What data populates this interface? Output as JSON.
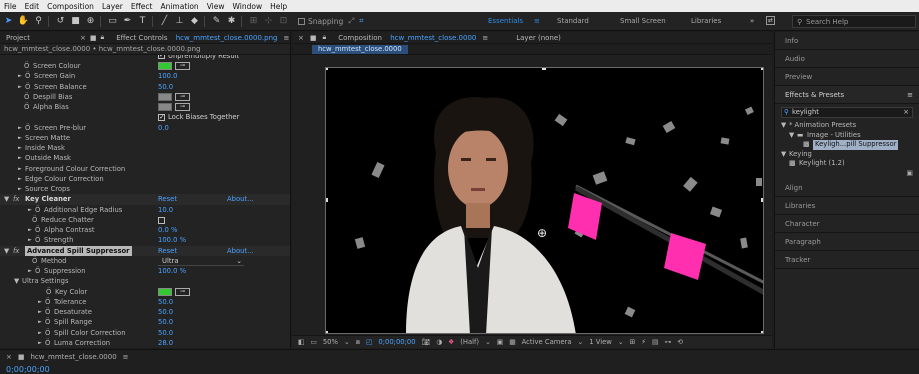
{
  "menubar": [
    "File",
    "Edit",
    "Composition",
    "Layer",
    "Effect",
    "Animation",
    "View",
    "Window",
    "Help"
  ],
  "toolbar": {
    "snapping_label": "Snapping",
    "workspaces": [
      "Essentials",
      "Standard",
      "Small Screen",
      "Libraries"
    ],
    "active_workspace": "Essentials",
    "search_help_placeholder": "Search Help"
  },
  "left_panel": {
    "project_tab": "Project",
    "effect_controls_tab_prefix": "Effect Controls",
    "effect_controls_tab_file": "hcw_mmtest_close.0000.png",
    "source_path": "hcw_mmtest_close.0000 • hcw_mmtest_close.0000.png",
    "rows": [
      {
        "name": "Unpremultiply Result",
        "indent": 150,
        "kind": "text_white",
        "partial": true
      },
      {
        "name": "Screen Colour",
        "indent": 24,
        "kind": "swatch_green"
      },
      {
        "name": "Screen Gain",
        "indent": 18,
        "arrow": true,
        "value": "100.0"
      },
      {
        "name": "Screen Balance",
        "indent": 18,
        "arrow": true,
        "value": "50.0"
      },
      {
        "name": "Despill Bias",
        "indent": 24,
        "kind": "swatch_grey"
      },
      {
        "name": "Alpha Bias",
        "indent": 24,
        "kind": "swatch_grey"
      },
      {
        "name": "Lock Biases Together",
        "indent": 158,
        "kind": "checkbox_on"
      },
      {
        "name": "Screen Pre-blur",
        "indent": 18,
        "arrow": true,
        "value": "0.0"
      },
      {
        "name": "Screen Matte",
        "indent": 18,
        "arrow": true,
        "noicon": true
      },
      {
        "name": "Inside Mask",
        "indent": 18,
        "arrow": true,
        "noicon": true
      },
      {
        "name": "Outside Mask",
        "indent": 18,
        "arrow": true,
        "noicon": true
      },
      {
        "name": "Foreground Colour Correction",
        "indent": 18,
        "arrow": true,
        "noicon": true
      },
      {
        "name": "Edge Colour Correction",
        "indent": 18,
        "arrow": true,
        "noicon": true
      },
      {
        "name": "Source Crops",
        "indent": 18,
        "arrow": true,
        "noicon": true
      },
      {
        "name": "Key Cleaner",
        "indent": 4,
        "kind": "effect_header",
        "reset": "Reset",
        "about": "About..."
      },
      {
        "name": "Additional Edge Radius",
        "indent": 28,
        "arrow": true,
        "value": "10.0"
      },
      {
        "name": "Reduce Chatter",
        "indent": 32,
        "kind": "checkbox_off"
      },
      {
        "name": "Alpha Contrast",
        "indent": 28,
        "arrow": true,
        "value": "0.0 %"
      },
      {
        "name": "Strength",
        "indent": 28,
        "arrow": true,
        "value": "100.0 %"
      },
      {
        "name": "Advanced Spill Suppressor",
        "indent": 4,
        "kind": "effect_header_selected",
        "reset": "Reset",
        "about": "About..."
      },
      {
        "name": "Method",
        "indent": 32,
        "kind": "dropdown",
        "value": "Ultra"
      },
      {
        "name": "Suppression",
        "indent": 28,
        "arrow": true,
        "value": "100.0 %"
      },
      {
        "name": "Ultra Settings",
        "indent": 14,
        "kind": "group_open"
      },
      {
        "name": "Key Color",
        "indent": 46,
        "kind": "swatch_green"
      },
      {
        "name": "Tolerance",
        "indent": 38,
        "arrow": true,
        "value": "50.0"
      },
      {
        "name": "Desaturate",
        "indent": 38,
        "arrow": true,
        "value": "50.0"
      },
      {
        "name": "Spill Range",
        "indent": 38,
        "arrow": true,
        "value": "50.0"
      },
      {
        "name": "Spill Color Correction",
        "indent": 38,
        "arrow": true,
        "value": "50.0"
      },
      {
        "name": "Luma Correction",
        "indent": 38,
        "arrow": true,
        "value": "28.0"
      }
    ]
  },
  "composition": {
    "tab_prefix": "Composition",
    "tab_name": "hcw_mmtest_close.0000",
    "layer_tab": "Layer (none)",
    "chip": "hcw_mmtest_close.0000",
    "zoom": "50%",
    "timecode": "0;00;00;00",
    "resolution": "(Half)",
    "camera": "Active Camera",
    "views": "1 View"
  },
  "right_panel": {
    "panels_top": [
      "Info",
      "Audio",
      "Preview"
    ],
    "effects_presets": "Effects & Presets",
    "search_value": "keylight",
    "tree": [
      {
        "label": "* Animation Presets",
        "indent": 6,
        "arrow": "▼"
      },
      {
        "label": "Image - Utilities",
        "indent": 14,
        "arrow": "▼",
        "folder": true
      },
      {
        "label": "Keyligh...pill Suppressor",
        "indent": 38,
        "selected": true
      },
      {
        "label": "Keying",
        "indent": 6,
        "arrow": "▼"
      },
      {
        "label": "Keylight (1.2)",
        "indent": 24,
        "fx": true
      }
    ],
    "panels_bottom": [
      "Align",
      "Libraries",
      "Character",
      "Paragraph",
      "Tracker"
    ]
  },
  "timeline": {
    "tab_name": "hcw_mmtest_close.0000",
    "timecode": "0;00;00;00"
  },
  "colors": {
    "accent_blue": "#4aa3ff",
    "key_green": "#32c832",
    "magenta_card": "#ff2fb0"
  }
}
